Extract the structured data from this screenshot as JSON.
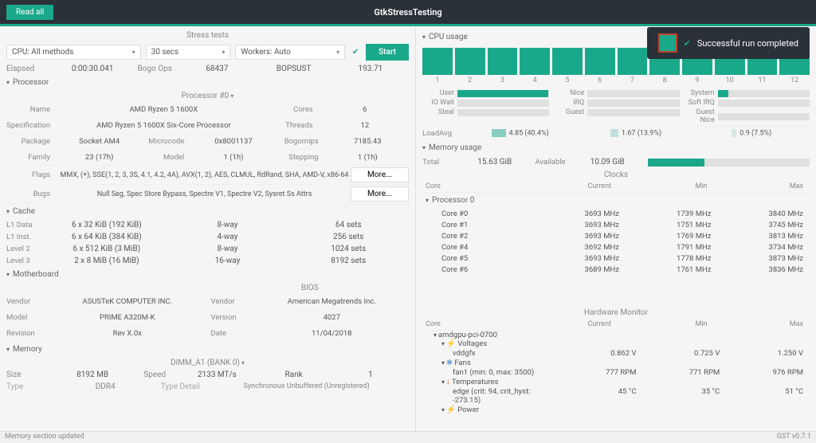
{
  "title": "GtkStressTesting",
  "read_all": "Read all",
  "notification": "Successful run completed",
  "stress": {
    "title": "Stress tests",
    "cpu_dd": "CPU: All methods",
    "time_dd": "30 secs",
    "workers_dd": "Workers: Auto",
    "start": "Start",
    "elapsed_l": "Elapsed",
    "elapsed_v": "0:00:30.041",
    "bogo_l": "Bogo Ops",
    "bogo_v": "68437",
    "op_l": "BOPSUST",
    "op_v": "193.71"
  },
  "processor": {
    "title": "Processor",
    "picker": "Processor #0",
    "rows": {
      "name_l": "Name",
      "name_v": "AMD Ryzen 5 1600X",
      "cores_l": "Cores",
      "cores_v": "6",
      "spec_l": "Specification",
      "spec_v": "AMD Ryzen 5 1600X Six-Core Processor",
      "threads_l": "Threads",
      "threads_v": "12",
      "pkg_l": "Package",
      "pkg_v": "Socket AM4",
      "micro_l": "Microcode",
      "micro_v": "0x8001137",
      "bogom_l": "Bogomips",
      "bogom_v": "7185.43",
      "fam_l": "Family",
      "fam_v": "23 (17h)",
      "model_l": "Model",
      "model_v": "1 (1h)",
      "step_l": "Stepping",
      "step_v": "1 (1h)",
      "flags_l": "Flags",
      "flags_v": "MMX, (+), SSE(1, 2, 3, 3S, 4.1, 4.2, 4A), AVX(1, 2), AES, CLMUL, RdRand, SHA, AMD-V, x86-64",
      "bugs_l": "Bugs",
      "bugs_v": "Null Seg, Spec Store Bypass, Spectre V1, Spectre V2, Sysret Ss Attrs",
      "more": "More..."
    }
  },
  "cache": {
    "title": "Cache",
    "rows": [
      {
        "l": "L1 Data",
        "size": "6 x 32 KiB (192 KiB)",
        "way": "8-way",
        "sets": "64 sets"
      },
      {
        "l": "L1 Inst.",
        "size": "6 x 64 KiB (384 KiB)",
        "way": "4-way",
        "sets": "256 sets"
      },
      {
        "l": "Level 2",
        "size": "6 x 512 KiB (3 MiB)",
        "way": "8-way",
        "sets": "1024 sets"
      },
      {
        "l": "Level 3",
        "size": "2 x 8 MiB (16 MiB)",
        "way": "16-way",
        "sets": "8192 sets"
      }
    ]
  },
  "mobo": {
    "title": "Motherboard",
    "bios_title": "BIOS",
    "vendor_l": "Vendor",
    "vendor_v": "ASUSTeK COMPUTER INC.",
    "model_l": "Model",
    "model_v": "PRIME A320M-K",
    "rev_l": "Revision",
    "rev_v": "Rev X.0x",
    "bvendor_l": "Vendor",
    "bvendor_v": "American Megatrends Inc.",
    "bver_l": "Version",
    "bver_v": "4027",
    "bdate_l": "Date",
    "bdate_v": "11/04/2018"
  },
  "memory": {
    "title": "Memory",
    "picker": "DIMM_A1 (BANK 0)",
    "size_l": "Size",
    "size_v": "8192 MB",
    "speed_l": "Speed",
    "speed_v": "2133 MT/s",
    "rank_l": "Rank",
    "rank_v": "1",
    "type_l": "Type",
    "type_v": "DDR4",
    "td_l": "Type Detail",
    "td_v": "Synchronous Unbuffered (Unregistered)"
  },
  "cpu_usage": {
    "title": "CPU usage",
    "labels": [
      "1",
      "2",
      "3",
      "4",
      "5",
      "6",
      "7",
      "8",
      "9",
      "10",
      "11",
      "12"
    ],
    "rows": [
      [
        "User",
        "Nice",
        "System"
      ],
      [
        "IO Wait",
        "IRQ",
        "Soft IRQ"
      ],
      [
        "Steal",
        "Guest",
        "Guest Nice"
      ]
    ],
    "user_pct": 99,
    "system_pct": 12,
    "loadavg_l": "LoadAvg",
    "load": [
      "4.85 (40.4%)",
      "1.67 (13.9%)",
      "0.9 (7.5%)"
    ]
  },
  "mem_usage": {
    "title": "Memory usage",
    "total_l": "Total",
    "total_v": "15.63 GiB",
    "avail_l": "Available",
    "avail_v": "10.09 GiB"
  },
  "clocks": {
    "title": "Clocks",
    "hdr": [
      "Core",
      "Current",
      "Min",
      "Max"
    ],
    "proc": "Processor 0",
    "rows": [
      [
        "Core #0",
        "3693 MHz",
        "1739 MHz",
        "3840 MHz"
      ],
      [
        "Core #1",
        "3693 MHz",
        "1751 MHz",
        "3745 MHz"
      ],
      [
        "Core #2",
        "3693 MHz",
        "1769 MHz",
        "3813 MHz"
      ],
      [
        "Core #4",
        "3692 MHz",
        "1791 MHz",
        "3734 MHz"
      ],
      [
        "Core #5",
        "3693 MHz",
        "1778 MHz",
        "3873 MHz"
      ],
      [
        "Core #6",
        "3689 MHz",
        "1761 MHz",
        "3836 MHz"
      ]
    ]
  },
  "hwmon": {
    "title": "Hardware Monitor",
    "hdr": [
      "Core",
      "Current",
      "Min",
      "Max"
    ],
    "dev": "amdgpu-pci-0700",
    "volt_l": "Voltages",
    "vdd": [
      "vddgfx",
      "0.862 V",
      "0.725 V",
      "1.250 V"
    ],
    "fans_l": "Fans",
    "fan": [
      "fan1 (min: 0, max: 3500)",
      "777 RPM",
      "771 RPM",
      "976 RPM"
    ],
    "temp_l": "Temperatures",
    "edge": [
      "edge (crit: 94, crit_hyst: -273.15)",
      "45 °C",
      "35 °C",
      "51 °C"
    ],
    "pwr_l": "Power"
  },
  "status": {
    "left": "Memory section updated",
    "right": "GST v0.7.1"
  }
}
